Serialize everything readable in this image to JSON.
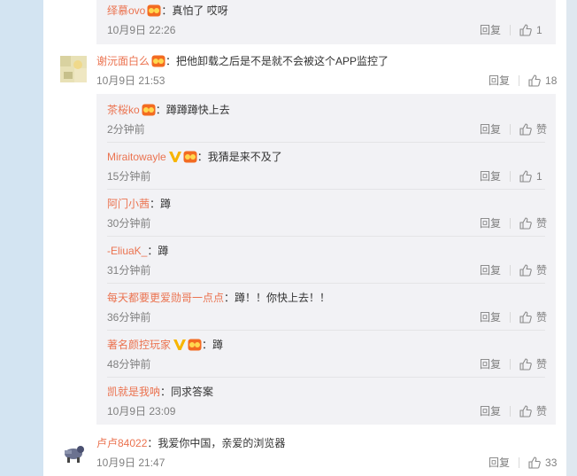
{
  "comments": [
    {
      "reply_to_prev": {
        "username": "绎慕ovo",
        "text": "：真怕了 哎呀",
        "time": "10月9日 22:26",
        "reply_label": "回复",
        "like_count": "1"
      }
    }
  ],
  "main1": {
    "username": "谢沅面白么",
    "text": "：把他卸载之后是不是就不会被这个APP监控了",
    "time": "10月9日 21:53",
    "reply_label": "回复",
    "like_count": "18",
    "replies": [
      {
        "username": "茶桜ko",
        "text": "：蹲蹲蹲快上去",
        "time": "2分钟前",
        "reply_label": "回复",
        "like_label": "赞",
        "verified": false,
        "badge": true
      },
      {
        "username": "Miraitowayle",
        "text": "：我猜是来不及了",
        "time": "15分钟前",
        "reply_label": "回复",
        "like_label": "1",
        "verified": true,
        "badge": true
      },
      {
        "username": "阿门小茜",
        "text": "：蹲",
        "time": "30分钟前",
        "reply_label": "回复",
        "like_label": "赞",
        "verified": false,
        "badge": false
      },
      {
        "username": "-EliuaK_",
        "text": "：蹲",
        "time": "31分钟前",
        "reply_label": "回复",
        "like_label": "赞",
        "verified": false,
        "badge": false
      },
      {
        "username": "每天都要更爱勋哥一点点",
        "text": "：蹲！！你快上去！！",
        "time": "36分钟前",
        "reply_label": "回复",
        "like_label": "赞",
        "verified": false,
        "badge": false
      },
      {
        "username": "著名颜控玩家",
        "text": "：蹲",
        "time": "48分钟前",
        "reply_label": "回复",
        "like_label": "赞",
        "verified": true,
        "badge": true
      },
      {
        "username": "凯就是我呐",
        "text": "：同求答案",
        "time": "10月9日 23:09",
        "reply_label": "回复",
        "like_label": "赞",
        "verified": false,
        "badge": false
      }
    ]
  },
  "main2": {
    "username": "卢卢84022",
    "text": "：我爱你中国，亲爱的浏览器",
    "time": "10月9日 21:47",
    "reply_label": "回复",
    "like_count": "33"
  },
  "colors": {
    "username": "#eb7350",
    "verified": "#f7b500",
    "badge": "#f36b21",
    "background": "#d3e4f2"
  }
}
